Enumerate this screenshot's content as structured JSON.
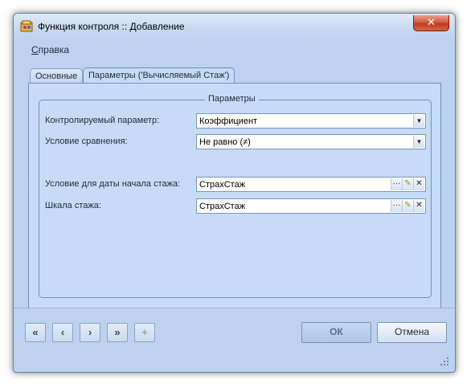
{
  "window": {
    "title": "Функция контроля :: Добавление",
    "close_label": "✕"
  },
  "menu": {
    "help_first": "С",
    "help_rest": "правка"
  },
  "tabs": [
    {
      "label": "Основные"
    },
    {
      "label": "Параметры ('Вычисляемый Стаж')"
    }
  ],
  "group": {
    "title": "Параметры",
    "fields": [
      {
        "label": "Контролируемый параметр:",
        "value": "Коэффициент"
      },
      {
        "label": "Условие сравнения:",
        "value": "Не равно (≠)"
      },
      {
        "label": "Условие для даты начала стажа:",
        "value": "СтрахСтаж"
      },
      {
        "label": "Шкала стажа:",
        "value": "СтрахСтаж"
      }
    ]
  },
  "nav": {
    "first": "«",
    "prev": "‹",
    "next": "›",
    "last": "»",
    "add": "+"
  },
  "buttons": {
    "ok": "ОК",
    "cancel": "Отмена"
  },
  "icons": {
    "dropdown": "▼",
    "ellipsis": "···",
    "edit": "✎",
    "clear": "✕"
  }
}
